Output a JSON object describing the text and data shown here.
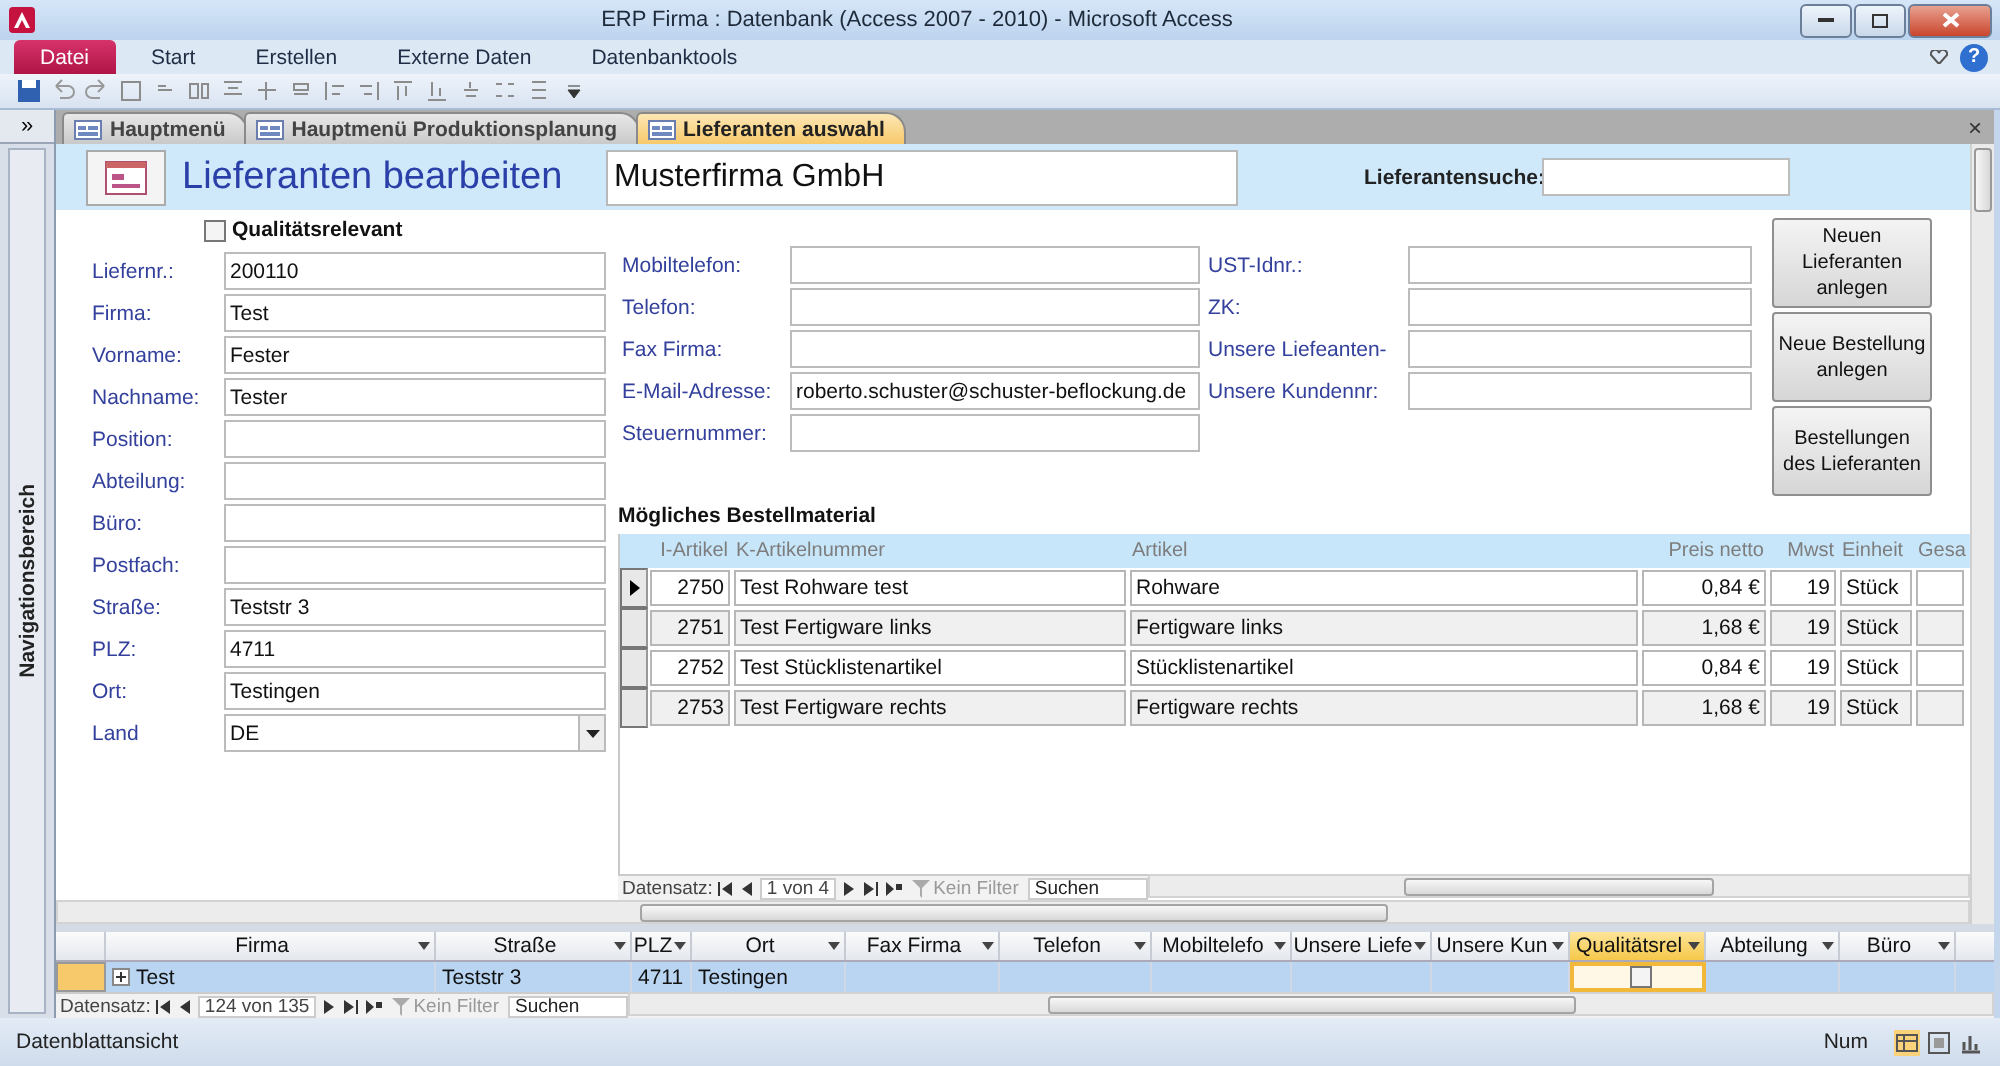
{
  "window": {
    "title": "ERP Firma : Datenbank (Access 2007 - 2010)  -  Microsoft Access",
    "help": "?"
  },
  "ribbon_tabs": [
    {
      "label": "Datei",
      "kind": "file"
    },
    {
      "label": "Start",
      "kind": "tab"
    },
    {
      "label": "Erstellen",
      "kind": "tab"
    },
    {
      "label": "Externe Daten",
      "kind": "tab"
    },
    {
      "label": "Datenbanktools",
      "kind": "tab"
    }
  ],
  "navigation_pane": {
    "toggle": "»",
    "label": "Navigationsbereich"
  },
  "document_tabs": [
    {
      "label": "Hauptmenü",
      "selected": false
    },
    {
      "label": "Hauptmenü Produktionsplanung",
      "selected": false
    },
    {
      "label": "Lieferanten auswahl",
      "selected": true
    }
  ],
  "document_close": "×",
  "form": {
    "title": "Lieferanten bearbeiten",
    "company": "Musterfirma GmbH",
    "search": {
      "label": "Lieferantensuche:"
    },
    "quality_checkbox": {
      "label": "Qualitätsrelevant",
      "checked": false
    },
    "fields_left": [
      {
        "label": "Liefernr.:",
        "value": "200110",
        "kind": "text"
      },
      {
        "label": "Firma:",
        "value": "Test",
        "kind": "text"
      },
      {
        "label": "Vorname:",
        "value": "Fester",
        "kind": "text"
      },
      {
        "label": "Nachname:",
        "value": "Tester",
        "kind": "text"
      },
      {
        "label": "Position:",
        "kind": "text"
      },
      {
        "label": "Abteilung:",
        "kind": "text"
      },
      {
        "label": "Büro:",
        "kind": "text"
      },
      {
        "label": "Postfach:",
        "kind": "text"
      },
      {
        "label": "Straße:",
        "value": "Teststr 3",
        "kind": "text"
      },
      {
        "label": "PLZ:",
        "value": "4711",
        "kind": "text"
      },
      {
        "label": "Ort:",
        "value": "Testingen",
        "kind": "text"
      },
      {
        "label": "Land",
        "value": "DE",
        "kind": "combo"
      }
    ],
    "fields_middle": [
      {
        "label": "Mobiltelefon:"
      },
      {
        "label": "Telefon:"
      },
      {
        "label": "Fax Firma:"
      },
      {
        "label": "E-Mail-Adresse:",
        "value": "roberto.schuster@schuster-beflockung.de"
      },
      {
        "label": "Steuernummer:"
      }
    ],
    "fields_right": [
      {
        "label": "UST-Idnr.:"
      },
      {
        "label": "ZK:"
      },
      {
        "label": "Unsere Liefeanten-"
      },
      {
        "label": "Unsere Kundennr:"
      }
    ],
    "buttons": [
      "Neuen Lieferanten anlegen",
      "Neue Bestellung anlegen",
      "Bestellungen des Lieferanten"
    ],
    "subform": {
      "title": "Mögliches Bestellmaterial",
      "columns": [
        "I-Artikel",
        "K-Artikelnummer",
        "Artikel",
        "Preis netto",
        "Mwst",
        "Einheit",
        "Gesa"
      ],
      "rows": [
        {
          "selected": true,
          "cells": [
            "2750",
            "Test Rohware test",
            "Rohware",
            "0,84 €",
            "19",
            "Stück"
          ]
        },
        {
          "selected": false,
          "cells": [
            "2751",
            "Test Fertigware links",
            "Fertigware links",
            "1,68 €",
            "19",
            "Stück"
          ]
        },
        {
          "selected": false,
          "cells": [
            "2752",
            "Test Stücklistenartikel",
            "Stücklistenartikel",
            "0,84 €",
            "19",
            "Stück"
          ]
        },
        {
          "selected": false,
          "cells": [
            "2753",
            "Test Fertigware rechts",
            "Fertigware rechts",
            "1,68 €",
            "19",
            "Stück"
          ]
        }
      ],
      "navigator": {
        "label": "Datensatz:",
        "position": "1 von 4",
        "filter": "Kein Filter",
        "search": {
          "placeholder": "Suchen"
        }
      }
    }
  },
  "datasheet": {
    "columns": [
      {
        "label": "Firma",
        "kind": "text",
        "selected": false
      },
      {
        "label": "Straße",
        "kind": "text",
        "selected": false
      },
      {
        "label": "PLZ",
        "kind": "text",
        "selected": false
      },
      {
        "label": "Ort",
        "kind": "text",
        "selected": false
      },
      {
        "label": "Fax Firma",
        "kind": "text",
        "selected": false
      },
      {
        "label": "Telefon",
        "kind": "text",
        "selected": false
      },
      {
        "label": "Mobiltelefo",
        "kind": "text",
        "selected": false
      },
      {
        "label": "Unsere Liefe",
        "kind": "text",
        "selected": false
      },
      {
        "label": "Unsere Kun",
        "kind": "text",
        "selected": false
      },
      {
        "label": "Qualitätsrel",
        "kind": "checkbox",
        "selected": true
      },
      {
        "label": "Abteilung",
        "kind": "text",
        "selected": false
      },
      {
        "label": "Büro",
        "kind": "text",
        "selected": false
      }
    ],
    "rows": [
      {
        "selected": true,
        "cells": [
          "Test",
          "Teststr 3",
          "4711",
          "Testingen"
        ],
        "checked": false
      }
    ],
    "navigator": {
      "label": "Datensatz:",
      "position": "124 von 135",
      "filter": "Kein Filter",
      "search": {
        "placeholder": "Suchen"
      }
    }
  },
  "status_bar": {
    "view": "Datenblattansicht",
    "indicator": "Num"
  }
}
